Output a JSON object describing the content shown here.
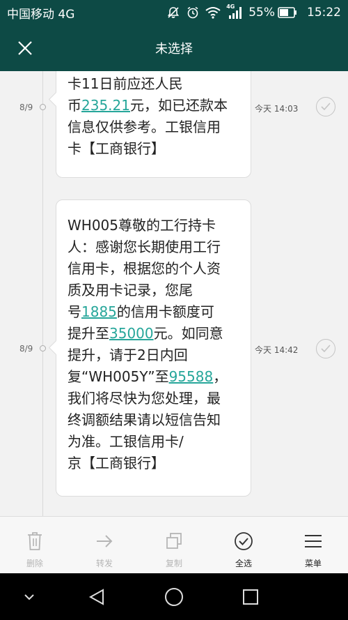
{
  "status_bar": {
    "carrier": "中国移动 4G",
    "battery_percent": "55%",
    "time": "15:22",
    "network_badge": "4G",
    "icons": [
      "mute-icon",
      "alarm-icon",
      "wifi-icon",
      "signal-icon",
      "battery-icon"
    ]
  },
  "header": {
    "title": "未选择"
  },
  "messages": [
    {
      "date": "8/9",
      "time": "今天 14:03",
      "lines": [
        [
          {
            "t": "卡11日前应还人民"
          }
        ],
        [
          {
            "t": "币"
          },
          {
            "t": "235.21",
            "link": true
          },
          {
            "t": "元，如已还款本"
          }
        ],
        [
          {
            "t": "信息仅供参考。工银信用"
          }
        ],
        [
          {
            "t": "卡【工商银行】"
          }
        ]
      ]
    },
    {
      "date": "8/9",
      "time": "今天 14:42",
      "lines": [
        [
          {
            "t": "WH005尊敬的工行持卡"
          }
        ],
        [
          {
            "t": "人：感谢您长期使用工行"
          }
        ],
        [
          {
            "t": "信用卡，根据您的个人资"
          }
        ],
        [
          {
            "t": "质及用卡记录，您尾"
          }
        ],
        [
          {
            "t": "号"
          },
          {
            "t": "1885",
            "link": true
          },
          {
            "t": "的信用卡额度可"
          }
        ],
        [
          {
            "t": "提升至"
          },
          {
            "t": "35000",
            "link": true
          },
          {
            "t": "元。如同意"
          }
        ],
        [
          {
            "t": "提升，请于2日内回"
          }
        ],
        [
          {
            "t": "复“WH005Y”至"
          },
          {
            "t": "95588",
            "link": true
          },
          {
            "t": "，"
          }
        ],
        [
          {
            "t": "我们将尽快为您处理，最"
          }
        ],
        [
          {
            "t": "终调额结果请以短信告知"
          }
        ],
        [
          {
            "t": "为准。工银信用卡/"
          }
        ],
        [
          {
            "t": "京【工商银行】"
          }
        ]
      ]
    }
  ],
  "actions": [
    {
      "label": "删除",
      "icon": "trash-icon",
      "enabled": false
    },
    {
      "label": "转发",
      "icon": "forward-arrow-icon",
      "enabled": false
    },
    {
      "label": "复制",
      "icon": "copy-icon",
      "enabled": false
    },
    {
      "label": "全选",
      "icon": "check-circle-icon",
      "enabled": true
    },
    {
      "label": "菜单",
      "icon": "menu-icon",
      "enabled": true
    }
  ],
  "nav": {
    "icons": [
      "collapse-chevron-icon",
      "back-icon",
      "home-icon",
      "recents-icon"
    ]
  },
  "colors": {
    "header_bg": "#0d4a45",
    "link": "#26a69a",
    "disabled_label": "#b5b5b5"
  }
}
